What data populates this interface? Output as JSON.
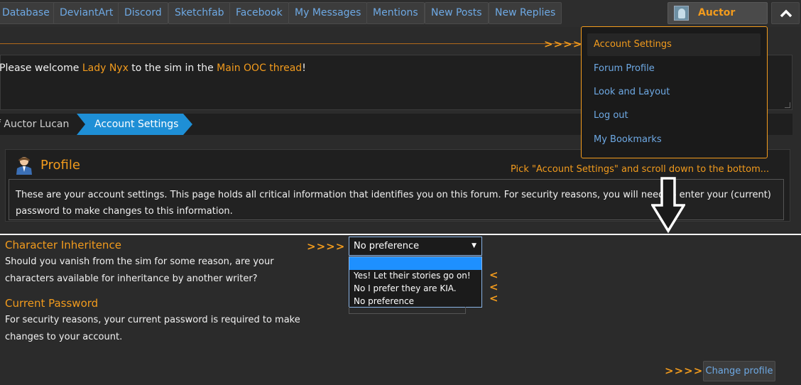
{
  "nav": {
    "items": [
      "Database",
      "DeviantArt",
      "Discord",
      "Sketchfab",
      "Facebook",
      "My Messages",
      "Mentions",
      "New Posts",
      "New Replies"
    ],
    "user_label": "Auctor Lucan"
  },
  "annotation_arrows": ">>>>",
  "notice": {
    "pre": "Please welcome ",
    "name": "Lady Nyx",
    "mid": " to the sim in the ",
    "link": "Main OOC thread",
    "post": "!"
  },
  "breadcrumb": {
    "parent": "f Auctor Lucan",
    "current": "Account Settings"
  },
  "profile": {
    "title": "Profile",
    "body": "These are your account settings. This page holds all critical information that identifies you on this forum. For security reasons, you will need to enter your (current) password to make changes to this information."
  },
  "callout": "Pick \"Account Settings\" and scroll down to the bottom...",
  "user_menu": {
    "items": [
      "Account Settings",
      "Forum Profile",
      "Look and Layout",
      "Log out",
      "My Bookmarks"
    ]
  },
  "form": {
    "inheritance": {
      "title": "Character Inheritence",
      "desc": "Should you vanish from the sim for some reason, are your characters available for inheritance by another writer?",
      "selected": "No preference",
      "options": [
        "Yes! Let their stories go on!",
        "No I prefer they are KIA.",
        "No preference"
      ]
    },
    "password": {
      "title": "Current Password",
      "desc": "For security reasons, your current password is required to make changes to your account."
    },
    "option_marker": "<"
  },
  "change_profile_label": "Change profile",
  "colors": {
    "accent": "#f29b1d",
    "link": "#6ea9e4",
    "breadcrumb_active": "#1e8fd6"
  }
}
